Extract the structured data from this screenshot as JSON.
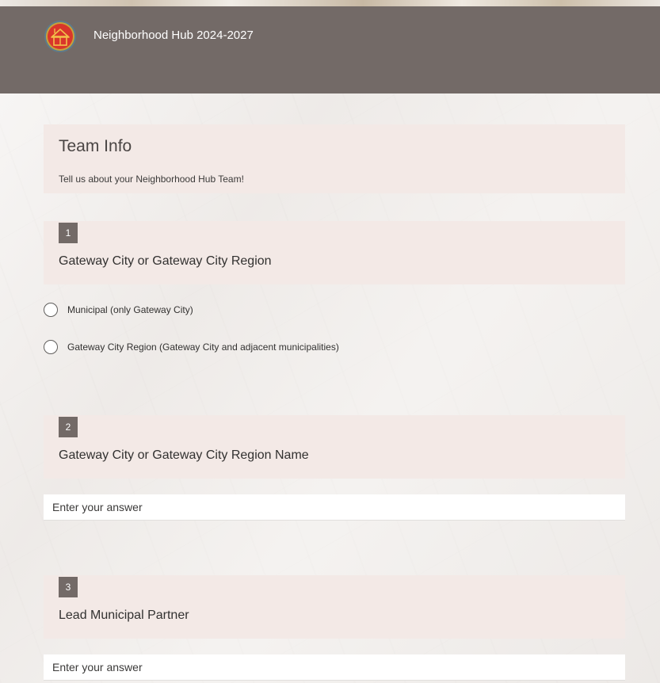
{
  "header": {
    "title": "Neighborhood Hub 2024-2027",
    "logo_icon": "house-logo-icon",
    "background_color": "#736a67"
  },
  "section": {
    "title": "Team Info",
    "description": "Tell us about your Neighborhood Hub Team!"
  },
  "questions": [
    {
      "number": "1",
      "title": "Gateway City or Gateway City Region",
      "type": "radio",
      "options": [
        "Municipal (only Gateway City)",
        "Gateway City Region (Gateway City and adjacent municipalities)"
      ]
    },
    {
      "number": "2",
      "title": "Gateway City or Gateway City Region Name",
      "type": "text",
      "placeholder": "Enter your answer"
    },
    {
      "number": "3",
      "title": "Lead Municipal Partner",
      "type": "text",
      "placeholder": "Enter your answer"
    }
  ],
  "colors": {
    "card_background": "#f3e9e6",
    "number_badge": "#736a67"
  }
}
